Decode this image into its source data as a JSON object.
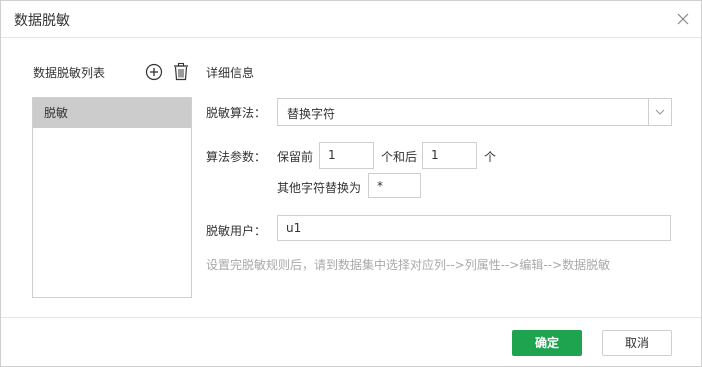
{
  "dialog": {
    "title": "数据脱敏",
    "close_icon": "close-icon"
  },
  "list_panel": {
    "label": "数据脱敏列表",
    "add_icon": "plus-circle-icon",
    "delete_icon": "trash-icon",
    "items": [
      {
        "label": "脱敏",
        "selected": true
      }
    ]
  },
  "detail": {
    "label": "详细信息",
    "algorithm_label": "脱敏算法：",
    "algorithm_value": "替换字符",
    "params_label": "算法参数：",
    "keep_front_label": "保留前",
    "keep_front_value": "1",
    "and_back_label": "个和后",
    "keep_back_value": "1",
    "unit_label": "个",
    "replace_label": "其他字符替换为",
    "replace_value": "*",
    "users_label": "脱敏用户：",
    "users_value": "u1",
    "hint": "设置完脱敏规则后，请到数据集中选择对应列-->列属性-->编辑-->数据脱敏"
  },
  "footer": {
    "ok_label": "确定",
    "cancel_label": "取消",
    "ok_color": "#1ea34f"
  }
}
